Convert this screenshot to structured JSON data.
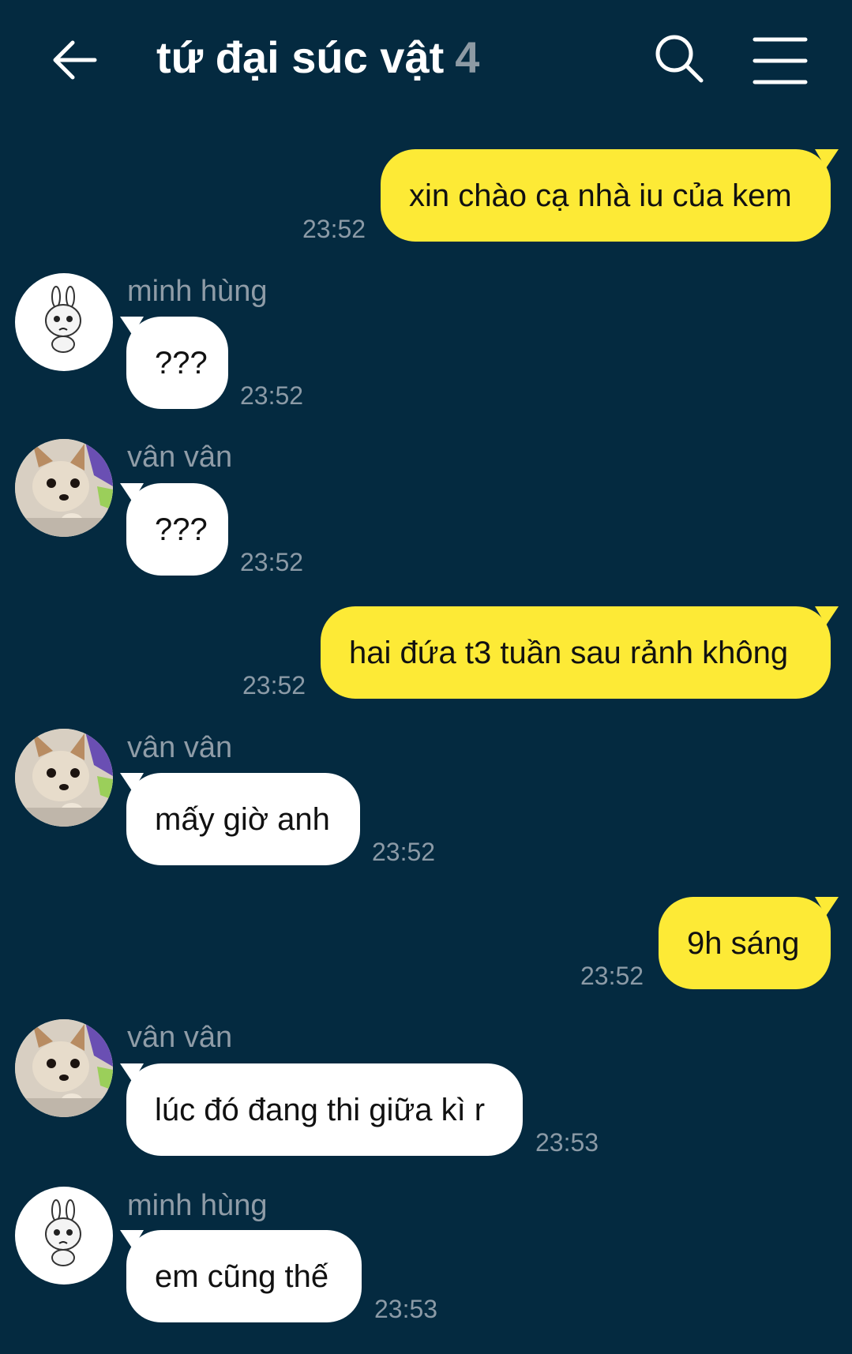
{
  "header": {
    "title": "tứ đại súc vật",
    "member_count": "4"
  },
  "messages": [
    {
      "text": "xin chào cạ nhà iu của kem",
      "time": "23:52"
    },
    {
      "sender": "minh hùng",
      "text": "???",
      "time": "23:52"
    },
    {
      "sender": "vân vân",
      "text": "???",
      "time": "23:52"
    },
    {
      "text": "hai đứa t3 tuần sau rảnh không",
      "time": "23:52"
    },
    {
      "sender": "vân vân",
      "text": "mấy giờ anh",
      "time": "23:52"
    },
    {
      "text": "9h sáng",
      "time": "23:52"
    },
    {
      "sender": "vân vân",
      "text": "lúc đó đang thi giữa kì r",
      "time": "23:53"
    },
    {
      "sender": "minh hùng",
      "text": "em cũng thế",
      "time": "23:53"
    }
  ],
  "colors": {
    "background": "#042a40",
    "my_bubble": "#fdea36",
    "their_bubble": "#ffffff",
    "meta_text": "#8b9aa6"
  },
  "icons": {
    "back": "arrow-left-icon",
    "search": "search-icon",
    "menu": "hamburger-menu-icon"
  }
}
